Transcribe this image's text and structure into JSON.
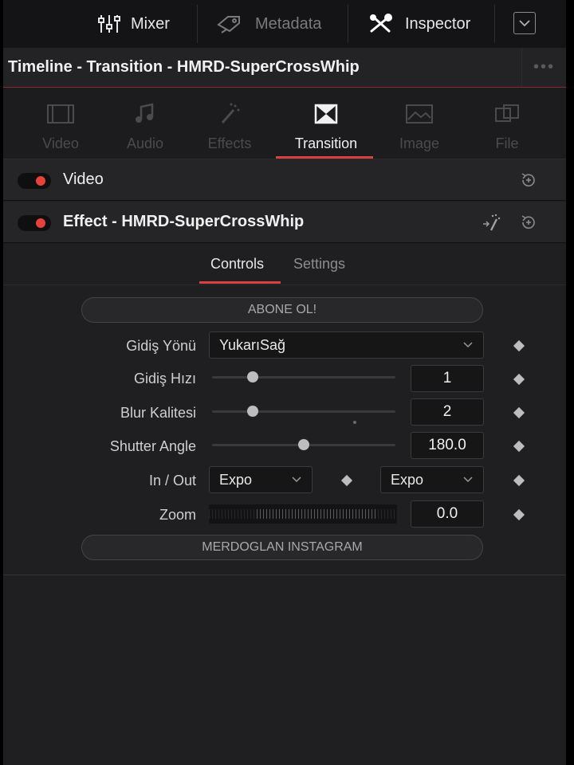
{
  "toolbar": {
    "mixer_label": "Mixer",
    "metadata_label": "Metadata",
    "inspector_label": "Inspector",
    "mixer_icon": "mixer-sliders-icon",
    "metadata_icon": "metadata-tag-icon",
    "inspector_icon": "inspector-tools-icon",
    "collapse_icon": "chevron-down-icon"
  },
  "titlebar": {
    "title": "Timeline - Transition - HMRD-SuperCrossWhip",
    "more_icon": "more-dots-icon"
  },
  "tabs": [
    {
      "label": "Video",
      "icon": "film-icon",
      "active": false
    },
    {
      "label": "Audio",
      "icon": "music-note-icon",
      "active": false
    },
    {
      "label": "Effects",
      "icon": "magic-wand-icon",
      "active": false
    },
    {
      "label": "Transition",
      "icon": "transition-icon",
      "active": true
    },
    {
      "label": "Image",
      "icon": "image-icon",
      "active": false
    },
    {
      "label": "File",
      "icon": "file-icon",
      "active": false
    }
  ],
  "sections": {
    "video": {
      "title": "Video",
      "enabled": true
    },
    "effect": {
      "title": "Effect - HMRD-SuperCrossWhip",
      "enabled": true
    }
  },
  "subtabs": {
    "controls": "Controls",
    "settings": "Settings",
    "active": "Controls"
  },
  "controls": {
    "top_button": "ABONE OL!",
    "bottom_button": "MERDOGLAN INSTAGRAM",
    "direction": {
      "label": "Gidiş Yönü",
      "value": "YukarıSağ"
    },
    "speed": {
      "label": "Gidiş Hızı",
      "value": "1",
      "slider_fraction": 0.22
    },
    "blur": {
      "label": "Blur Kalitesi",
      "value": "2",
      "slider_fraction": 0.22
    },
    "shutter": {
      "label": "Shutter Angle",
      "value": "180.0",
      "slider_fraction": 0.5
    },
    "inout": {
      "label": "In / Out",
      "in_value": "Expo",
      "out_value": "Expo"
    },
    "zoom": {
      "label": "Zoom",
      "value": "0.0"
    }
  },
  "colors": {
    "accent": "#d8413f",
    "panel_bg": "#1f1f21",
    "toggle_on": "#e8403a"
  }
}
